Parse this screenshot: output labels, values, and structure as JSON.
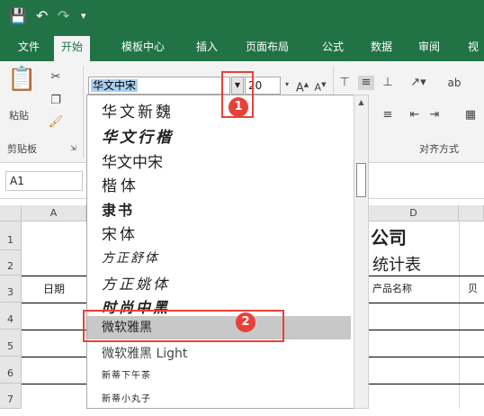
{
  "titlebar": {
    "save_icon": "save-icon",
    "undo_icon": "undo-icon",
    "redo_icon": "redo-icon",
    "customize_icon": "customize-icon"
  },
  "tabs": [
    "文件",
    "开始",
    "模板中心",
    "插入",
    "页面布局",
    "公式",
    "数据",
    "审阅",
    "视"
  ],
  "ribbon": {
    "paste_label": "粘贴",
    "clipboard_group": "剪贴板",
    "font_name_value": "华文中宋",
    "font_size_value": "20",
    "grow_font": "A",
    "shrink_font": "A",
    "align_group": "对齐方式",
    "wrap_label": "ab"
  },
  "formula": {
    "name_box": "A1"
  },
  "columns": [
    "A",
    "D"
  ],
  "rows": [
    "1",
    "2",
    "3",
    "4",
    "5",
    "6",
    "7"
  ],
  "cells": {
    "a3": "日期",
    "d1": "公司",
    "d2": "统计表",
    "d3": "产品名称",
    "e3": "贝"
  },
  "font_list": [
    "华文新魏",
    "华文行楷",
    "华文中宋",
    "楷体",
    "隶书",
    "宋体",
    "方正舒体",
    "方正姚体",
    "时尚中黑",
    "微软雅黑",
    "微软雅黑 Light",
    "新蒂下午茶",
    "新蒂小丸子"
  ],
  "badges": {
    "one": "1",
    "two": "2"
  },
  "colors": {
    "accent": "#217346",
    "highlight": "#e8413a"
  }
}
